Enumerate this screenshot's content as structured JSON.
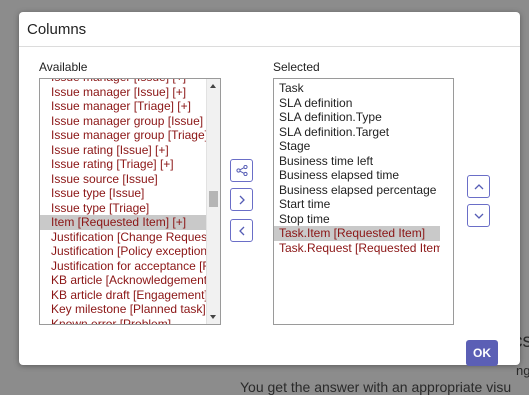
{
  "dialog": {
    "title": "Columns",
    "ok_label": "OK"
  },
  "background_text": {
    "line1": "cs",
    "line2": "ng",
    "line3": "You get the answer with an appropriate visu"
  },
  "available": {
    "label": "Available",
    "items": [
      "Issue manager [Issue] [+]",
      "Issue manager [Issue] [+]",
      "Issue manager [Triage] [+]",
      "Issue manager group [Issue] [+",
      "Issue manager group [Triage] [",
      "Issue rating [Issue] [+]",
      "Issue rating [Triage] [+]",
      "Issue source [Issue]",
      "Issue type [Issue]",
      "Issue type [Triage]",
      "Item [Requested Item] [+]",
      "Justification [Change Request",
      "Justification [Policy exception]",
      "Justification for acceptance [R",
      "KB article [Acknowledgement",
      "KB article draft [Engagement]",
      "Key milestone [Planned task]",
      "Known error [Problem]"
    ],
    "selected_index": 10
  },
  "selected": {
    "label": "Selected",
    "items": [
      "Task",
      "SLA definition",
      "SLA definition.Type",
      "SLA definition.Target",
      "Stage",
      "Business time left",
      "Business elapsed time",
      "Business elapsed percentage",
      "Start time",
      "Stop time",
      "Task.Item [Requested Item]",
      "Task.Request [Requested Item]"
    ],
    "selected_index": 10
  },
  "icons": {
    "transfer_buttons": [
      "share-nodes-icon",
      "chevron-right-icon",
      "chevron-left-icon"
    ],
    "order_buttons": [
      "chevron-up-icon",
      "chevron-down-icon"
    ]
  },
  "colors": {
    "accent": "#5b5fb5",
    "reference_field_text": "#8b1515",
    "selected_row": "#c9c9c9"
  }
}
